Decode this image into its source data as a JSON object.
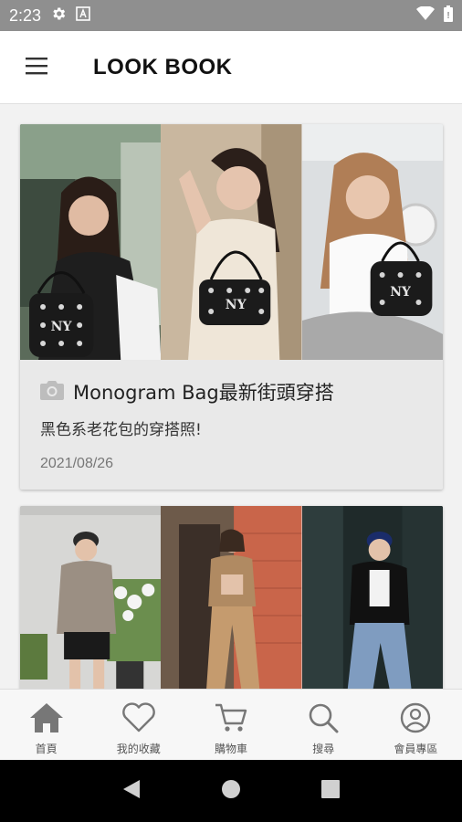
{
  "status_bar": {
    "time": "2:23",
    "icons": [
      "gear-icon",
      "text-a-icon",
      "wifi-icon",
      "battery-icon"
    ]
  },
  "header": {
    "menu_icon": "hamburger-menu-icon",
    "title": "LOOK BOOK"
  },
  "cards": [
    {
      "icon": "camera-icon",
      "title": "Monogram Bag最新街頭穿搭",
      "subtitle": "黑色系老花包的穿搭照!",
      "date": "2021/08/26",
      "photos": [
        "photo-woman-bucket-bag",
        "photo-woman-shoulder-bag",
        "photo-woman-monogram-bag"
      ]
    },
    {
      "photos": [
        "photo-woman-cap-sweater",
        "photo-woman-beige-outfit",
        "photo-woman-jeans-jacket"
      ]
    }
  ],
  "tab_bar": {
    "tabs": [
      {
        "label": "首頁",
        "icon": "home-icon"
      },
      {
        "label": "我的收藏",
        "icon": "heart-icon"
      },
      {
        "label": "購物車",
        "icon": "cart-icon"
      },
      {
        "label": "搜尋",
        "icon": "search-icon"
      },
      {
        "label": "會員專區",
        "icon": "user-icon"
      }
    ]
  },
  "nav_bar": {
    "buttons": [
      "back-icon",
      "home-circle-icon",
      "recents-icon"
    ]
  },
  "colors": {
    "status_bar": "#8f8f8f",
    "header_bg": "#ffffff",
    "card_bg": "#e9e9e9",
    "tab_icon": "#7a7a7a",
    "nav_bar": "#000000"
  }
}
